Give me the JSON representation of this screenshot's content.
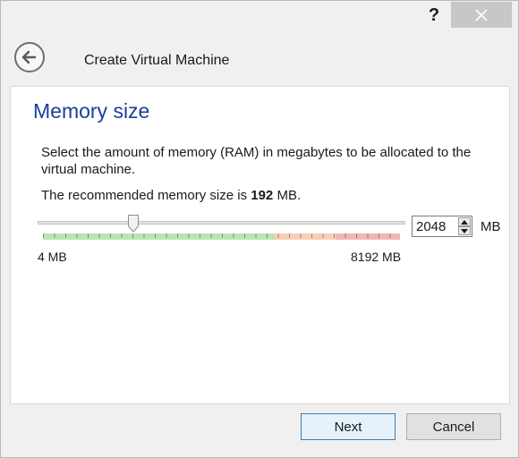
{
  "titlebar": {
    "help_label": "?",
    "help_icon": "question-mark-icon",
    "close_icon": "close-icon"
  },
  "header": {
    "back_icon": "back-arrow-icon",
    "title": "Create Virtual Machine"
  },
  "content": {
    "heading": "Memory size",
    "description": "Select the amount of memory (RAM) in megabytes to be allocated to the virtual machine.",
    "recommend_prefix": "The recommended memory size is ",
    "recommend_value": "192",
    "recommend_suffix": " MB."
  },
  "memory_slider": {
    "min_label": "4 MB",
    "max_label": "8192 MB",
    "min_value": 4,
    "max_value": 8192,
    "current_value": 2048,
    "zones": {
      "green": "#b8e6b0",
      "orange": "#f6d0b4",
      "red": "#f3b6b6"
    }
  },
  "memory_input": {
    "value": "2048",
    "unit": "MB"
  },
  "buttons": {
    "next": "Next",
    "cancel": "Cancel"
  },
  "colors": {
    "heading": "#1d3f9b",
    "next_border": "#3c7fb1",
    "next_bg": "#e5f1fb"
  }
}
